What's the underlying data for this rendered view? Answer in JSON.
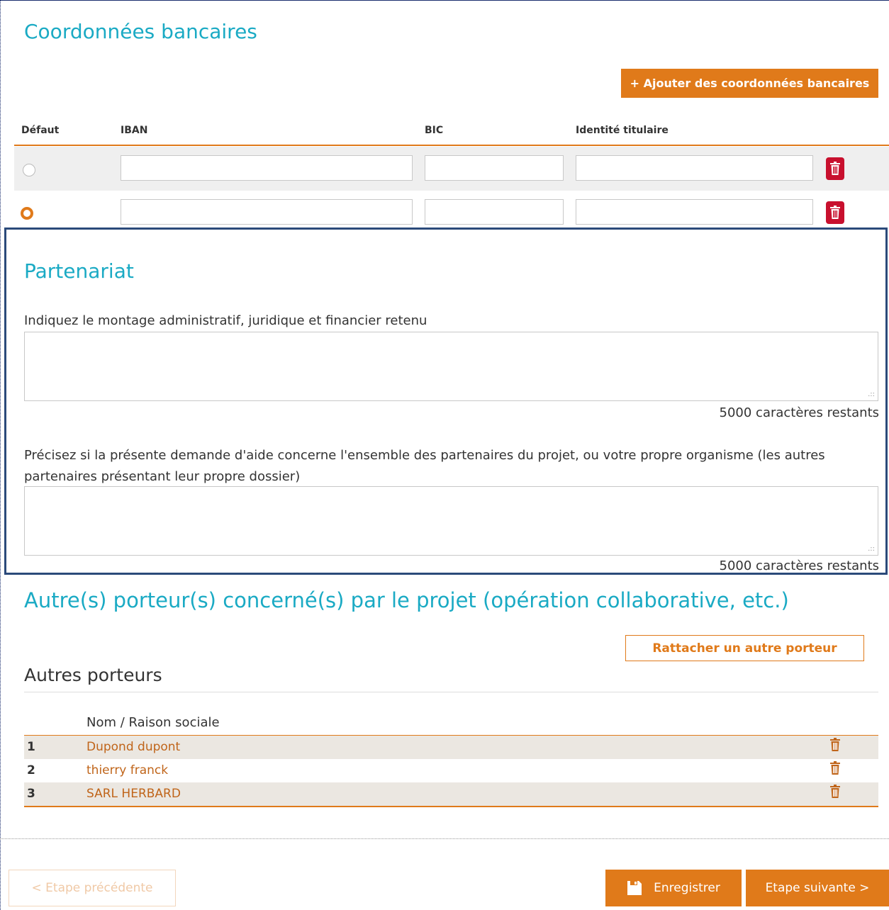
{
  "bank": {
    "title": "Coordonnées bancaires",
    "add_button": "+ Ajouter des coordonnées bancaires",
    "columns": {
      "default": "Défaut",
      "iban": "IBAN",
      "bic": "BIC",
      "holder": "Identité titulaire"
    },
    "rows": [
      {
        "selected": false,
        "iban": "",
        "bic": "",
        "holder": ""
      },
      {
        "selected": true,
        "iban": "",
        "bic": "",
        "holder": ""
      }
    ]
  },
  "partnership": {
    "title": "Partenariat",
    "q1_label": "Indiquez le montage administratif, juridique et financier retenu",
    "q1_value": "",
    "q1_counter": "5000 caractères restants",
    "q2_label": "Précisez si la présente demande d'aide concerne l'ensemble des partenaires du projet, ou votre propre organisme (les autres partenaires présentant leur propre dossier)",
    "q2_value": "",
    "q2_counter": "5000 caractères restants"
  },
  "carriers": {
    "title": "Autre(s) porteur(s) concerné(s) par le projet (opération collaborative, etc.)",
    "attach_button": "Rattacher un autre porteur",
    "subtitle": "Autres porteurs",
    "column_name": "Nom / Raison sociale",
    "rows": [
      {
        "num": "1",
        "name": "Dupond dupont"
      },
      {
        "num": "2",
        "name": "thierry franck"
      },
      {
        "num": "3",
        "name": "SARL HERBARD"
      }
    ]
  },
  "footer": {
    "prev": "< Etape précédente",
    "save": "Enregistrer",
    "next": "Etape suivante >"
  },
  "colors": {
    "accent": "#e07a1a",
    "title": "#1aaac4",
    "danger": "#c8102e",
    "highlight_border": "#2b4a7a"
  },
  "icons": {
    "trash": "trash-icon",
    "save": "floppy-disk-icon"
  }
}
